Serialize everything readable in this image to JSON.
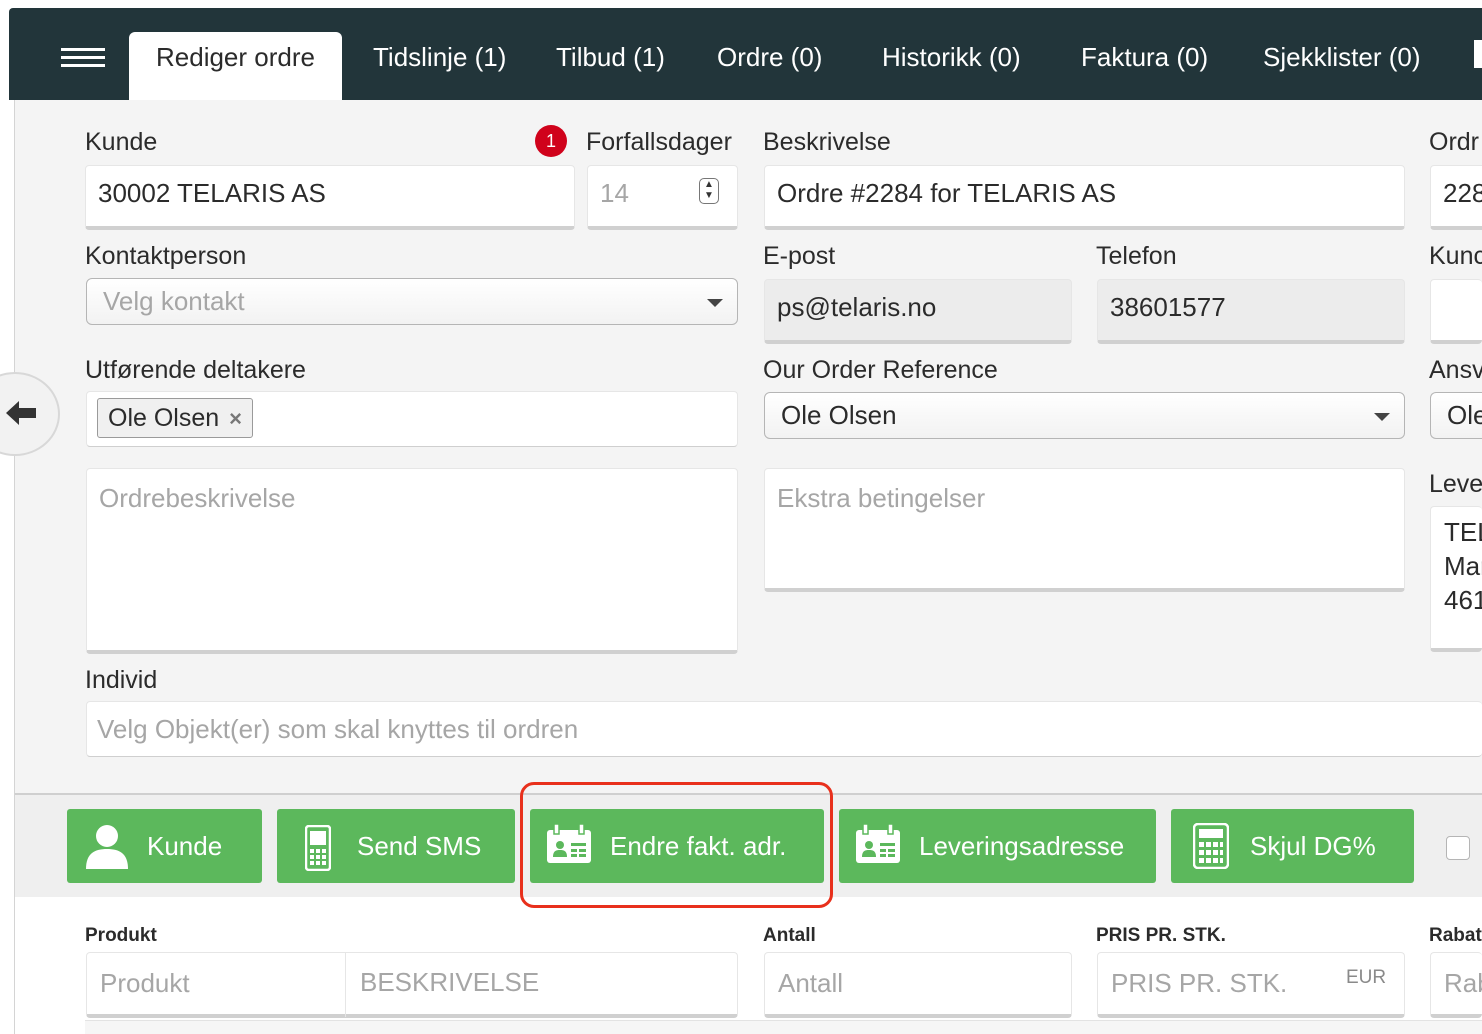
{
  "nav": {
    "tabs": [
      {
        "label": "Rediger ordre",
        "active": true
      },
      {
        "label": "Tidslinje (1)"
      },
      {
        "label": "Tilbud (1)"
      },
      {
        "label": "Ordre (0)"
      },
      {
        "label": "Historikk (0)"
      },
      {
        "label": "Faktura (0)"
      },
      {
        "label": "Sjekklister (0)"
      }
    ]
  },
  "form": {
    "kunde": {
      "label": "Kunde",
      "value": "30002 TELARIS AS",
      "badge": "1"
    },
    "forfallsdager": {
      "label": "Forfallsdager",
      "value": "14"
    },
    "beskrivelse": {
      "label": "Beskrivelse",
      "value": "Ordre #2284 for TELARIS AS"
    },
    "ordre_cut": {
      "label": "Ordr",
      "value": "228"
    },
    "kontaktperson": {
      "label": "Kontaktperson",
      "placeholder": "Velg kontakt"
    },
    "epost": {
      "label": "E-post",
      "value": "ps@telaris.no"
    },
    "telefon": {
      "label": "Telefon",
      "value": "38601577"
    },
    "kunde_cut": {
      "label": "Kunc"
    },
    "deltakere": {
      "label": "Utførende deltakere",
      "chip": "Ole Olsen",
      "chip_remove": "×"
    },
    "our_ref": {
      "label": "Our Order Reference",
      "value": "Ole Olsen"
    },
    "ansv_cut": {
      "label": "Ansv",
      "value": "Ole"
    },
    "ordrebeskrivelse": {
      "placeholder": "Ordrebeskrivelse"
    },
    "ekstra": {
      "placeholder": "Ekstra betingelser"
    },
    "leveranse_cut": {
      "label": "Leve",
      "lines": [
        "TEL",
        "Mar",
        "461"
      ]
    },
    "individ": {
      "label": "Individ",
      "placeholder": "Velg Objekt(er) som skal knyttes til ordren"
    }
  },
  "actions": {
    "buttons": [
      {
        "label": "Kunde",
        "icon": "user-icon"
      },
      {
        "label": "Send SMS",
        "icon": "mobile-phone-icon"
      },
      {
        "label": "Endre fakt. adr.",
        "icon": "address-card-icon"
      },
      {
        "label": "Leveringsadresse",
        "icon": "address-card-icon"
      },
      {
        "label": "Skjul DG%",
        "icon": "calculator-icon"
      }
    ],
    "accent": "#5cb85c",
    "highlight_color": "#e8301c"
  },
  "product": {
    "headers": {
      "produkt": "Produkt",
      "antall": "Antall",
      "pris": "PRIS PR. STK.",
      "rabatt_cut": "Rabat"
    },
    "placeholders": {
      "produkt": "Produkt",
      "beskrivelse": "BESKRIVELSE",
      "antall": "Antall",
      "pris": "PRIS PR. STK.",
      "rabatt_cut": "Rab"
    },
    "currency": "EUR"
  }
}
